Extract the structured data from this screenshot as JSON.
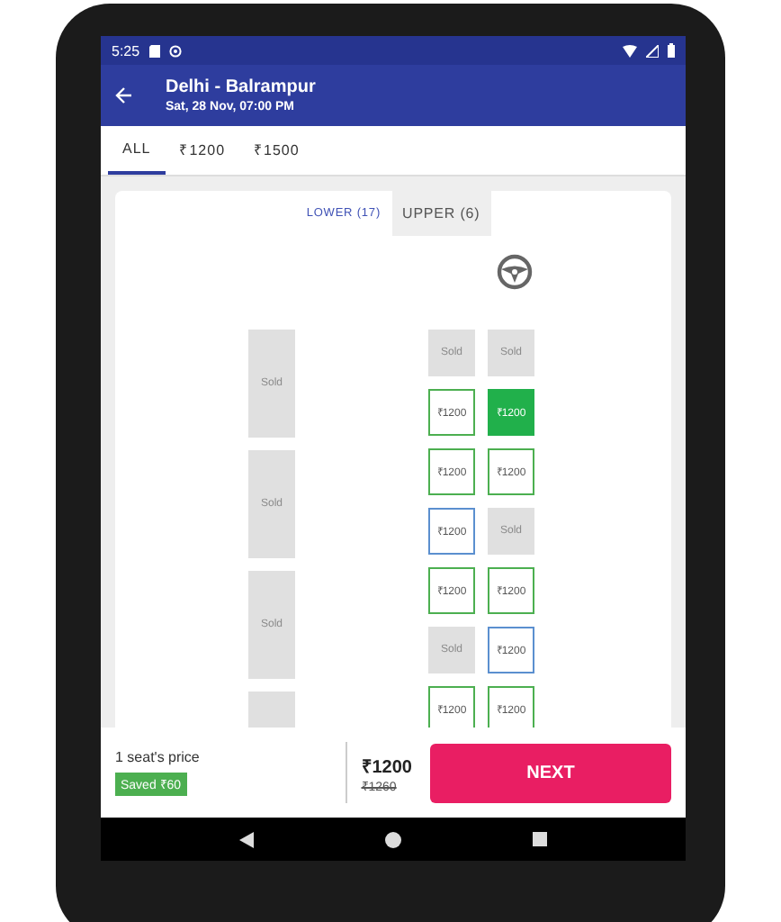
{
  "status_bar": {
    "time": "5:25"
  },
  "app_bar": {
    "title": "Delhi - Balrampur",
    "subtitle": "Sat, 28 Nov,  07:00 PM"
  },
  "price_tabs": [
    {
      "label": "ALL",
      "selected": true
    },
    {
      "label": "₹1200",
      "selected": false
    },
    {
      "label": "₹1500",
      "selected": false
    }
  ],
  "deck_tabs": [
    {
      "label": "LOWER (17)",
      "selected": false
    },
    {
      "label": "UPPER (6)",
      "selected": true
    }
  ],
  "sleepers": [
    {
      "kind": "sold",
      "label": "Sold"
    },
    {
      "kind": "sold",
      "label": "Sold"
    },
    {
      "kind": "sold",
      "label": "Sold"
    },
    {
      "kind": "sold"
    }
  ],
  "seats": [
    {
      "kind": "sold",
      "label": "Sold",
      "selected": false
    },
    {
      "kind": "sold",
      "label": "Sold",
      "selected": false
    },
    {
      "kind": "available",
      "label": "₹1200",
      "selected": false
    },
    {
      "kind": "available",
      "label": "₹1200",
      "selected": true
    },
    {
      "kind": "available",
      "label": "₹1200",
      "selected": false
    },
    {
      "kind": "available",
      "label": "₹1200",
      "selected": false
    },
    {
      "kind": "ladies",
      "label": "₹1200",
      "selected": false
    },
    {
      "kind": "sold",
      "label": "Sold",
      "selected": false
    },
    {
      "kind": "available",
      "label": "₹1200",
      "selected": false
    },
    {
      "kind": "available",
      "label": "₹1200",
      "selected": false
    },
    {
      "kind": "sold",
      "label": "Sold",
      "selected": false
    },
    {
      "kind": "ladies",
      "label": "₹1200",
      "selected": false
    },
    {
      "kind": "available",
      "label": "₹1200",
      "selected": false
    },
    {
      "kind": "available",
      "label": "₹1200",
      "selected": false
    }
  ],
  "footer": {
    "caption": "1 seat's price",
    "saved": "Saved ₹60",
    "price": "₹1200",
    "old_price": "₹1260",
    "button": "NEXT"
  }
}
